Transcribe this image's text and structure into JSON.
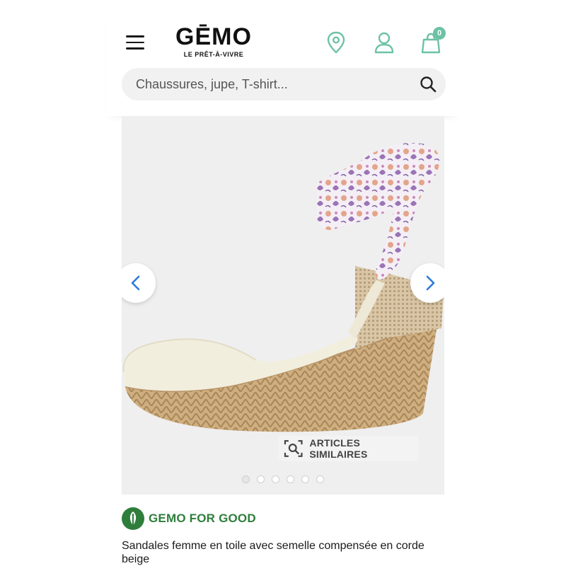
{
  "header": {
    "logo_word": "GĒMO",
    "logo_tagline": "LE PRÊT-À-VIVRE",
    "icons": [
      "menu-icon",
      "location-pin-icon",
      "user-icon",
      "shopping-bag-icon"
    ],
    "cart_count": "0",
    "accent_color": "#6cc2a5"
  },
  "search": {
    "placeholder": "Chaussures, jupe, T-shirt..."
  },
  "gallery": {
    "similar_label": "ARTICLES SIMILAIRES",
    "slide_count": 6,
    "active_slide": 1,
    "image_subject": "espadrille wedge sandal with floral ankle ties"
  },
  "brand_banner": {
    "label": "GEMO FOR GOOD",
    "color": "#2f7d3b"
  },
  "product": {
    "title": "Sandales femme en toile avec semelle compensée en corde beige"
  }
}
